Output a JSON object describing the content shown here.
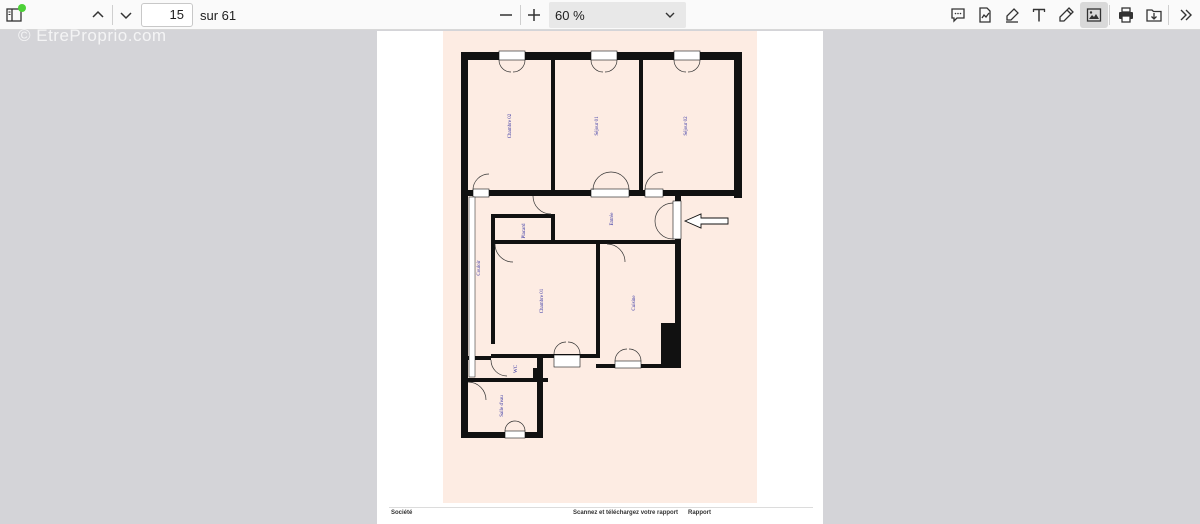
{
  "toolbar": {
    "page_number": "15",
    "page_total": "sur 61",
    "zoom": "60 %",
    "icons": [
      "sidebar-toggle-icon",
      "chevron-up-icon",
      "chevron-down-icon",
      "minus-icon",
      "plus-icon",
      "comment-icon",
      "sign-icon",
      "highlight-icon",
      "text-icon",
      "draw-icon",
      "image-icon",
      "print-icon",
      "save-icon",
      "more-icon"
    ]
  },
  "watermark": "© EtreProprio.com",
  "floorplan": {
    "rooms": [
      "Chambre 02",
      "Séjour 01",
      "Séjour 02",
      "Entrée",
      "Placard",
      "Couloir",
      "Chambre 01",
      "Cuisine",
      "WC",
      "Salle d'eau"
    ]
  },
  "footer": {
    "col1": "Société",
    "col2": "Scannez et téléchargez votre rapport",
    "col3": "Rapport"
  },
  "colors": {
    "toolbar_bg": "#fafafa",
    "viewer_bg": "#d4d4d8",
    "plan_bg": "#fdece3",
    "room_text": "#2a2aa0",
    "status_dot": "#4cd137"
  }
}
